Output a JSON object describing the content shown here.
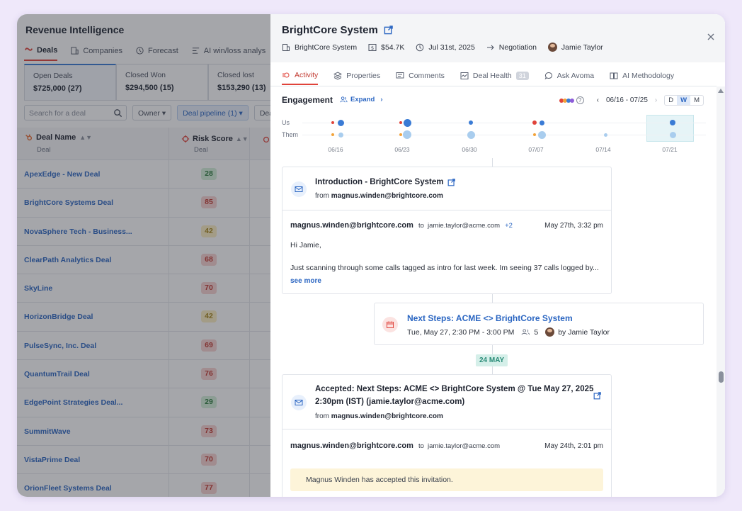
{
  "app": {
    "title": "Revenue Intelligence"
  },
  "nav_tabs": [
    {
      "label": "Deals",
      "icon": "deals-icon"
    },
    {
      "label": "Companies",
      "icon": "companies-icon"
    },
    {
      "label": "Forecast",
      "icon": "forecast-icon"
    },
    {
      "label": "AI win/loss analys",
      "icon": "ai-analysis-icon"
    }
  ],
  "stats": [
    {
      "label": "Open Deals",
      "value": "$725,000 (27)"
    },
    {
      "label": "Closed Won",
      "value": "$294,500 (15)"
    },
    {
      "label": "Closed lost",
      "value": "$153,290 (13)"
    }
  ],
  "filters": {
    "search_placeholder": "Search for a deal",
    "owner": "Owner",
    "pipeline": "Deal pipeline (1)",
    "more": "Dea"
  },
  "table": {
    "col_deal": "Deal Name",
    "col_deal_sub": "Deal",
    "col_risk": "Risk Score",
    "col_risk_sub": "Deal",
    "rows": [
      {
        "name": "ApexEdge - New Deal",
        "score": "28",
        "level": "g"
      },
      {
        "name": "BrightCore Systems Deal",
        "score": "85",
        "level": "r"
      },
      {
        "name": "NovaSphere Tech - Business...",
        "score": "42",
        "level": "y"
      },
      {
        "name": "ClearPath Analytics Deal",
        "score": "68",
        "level": "r"
      },
      {
        "name": "SkyLine",
        "score": "70",
        "level": "r"
      },
      {
        "name": "HorizonBridge Deal",
        "score": "42",
        "level": "y"
      },
      {
        "name": "PulseSync, Inc. Deal",
        "score": "69",
        "level": "r"
      },
      {
        "name": "QuantumTrail Deal",
        "score": "76",
        "level": "r"
      },
      {
        "name": "EdgePoint Strategies Deal...",
        "score": "29",
        "level": "g"
      },
      {
        "name": "SummitWave",
        "score": "73",
        "level": "r"
      },
      {
        "name": "VistaPrime Deal",
        "score": "70",
        "level": "r"
      },
      {
        "name": "OrionFleet Systems Deal",
        "score": "77",
        "level": "r"
      }
    ]
  },
  "panel": {
    "title": "BrightCore System",
    "meta": {
      "company": "BrightCore System",
      "amount": "$54.7K",
      "close_date": "Jul 31st, 2025",
      "stage": "Negotiation",
      "owner": "Jamie Taylor"
    },
    "tabs": [
      {
        "label": "Activity",
        "icon": "activity-icon"
      },
      {
        "label": "Properties",
        "icon": "layers-icon"
      },
      {
        "label": "Comments",
        "icon": "comment-icon"
      },
      {
        "label": "Deal Health",
        "icon": "health-icon",
        "count": "31"
      },
      {
        "label": "Ask Avoma",
        "icon": "chat-icon"
      },
      {
        "label": "AI Methodology",
        "icon": "methodology-icon"
      }
    ],
    "engagement": {
      "title": "Engagement",
      "expand": "Expand",
      "range": "06/16 - 07/25",
      "views": [
        "D",
        "W",
        "M"
      ],
      "active_view": "W",
      "row_us": "Us",
      "row_them": "Them",
      "dates": [
        "06/16",
        "06/23",
        "06/30",
        "07/07",
        "07/14",
        "07/21"
      ],
      "legend_colors": [
        "#e0433a",
        "#f2a33a",
        "#3a7bd5",
        "#8e5cd9"
      ]
    },
    "activities": [
      {
        "type": "email",
        "title": "Introduction - BrightCore System",
        "from_label": "from",
        "from": "magnus.winden@brightcore.com",
        "sender": "magnus.winden@brightcore.com",
        "to_label": "to",
        "to": "jamie.taylor@acme.com",
        "extra": "+2",
        "date": "May 27th, 3:32 pm",
        "greeting": "Hi Jamie,",
        "body": "Just scanning through some calls tagged as intro for last week. Im seeing 37 calls logged by...",
        "see_more": "see more"
      },
      {
        "type": "meeting",
        "title": "Next Steps: ACME <> BrightCore System",
        "time": "Tue, May 27, 2:30 PM - 3:00 PM",
        "attendees": "5",
        "by": "by Jamie Taylor"
      },
      {
        "type": "email",
        "title_line1": "Accepted: Next Steps: ACME <> BrightCore System @ Tue May 27, 2025",
        "title_line2": "2:30pm (IST) (jamie.taylor@acme.com)",
        "from_label": "from",
        "from": "magnus.winden@brightcore.com",
        "sender": "magnus.winden@brightcore.com",
        "to_label": "to",
        "to": "jamie.taylor@acme.com",
        "date": "May 24th, 2:01 pm",
        "notice": "Magnus Winden has accepted this invitation."
      }
    ],
    "date_divider": "24 MAY"
  }
}
